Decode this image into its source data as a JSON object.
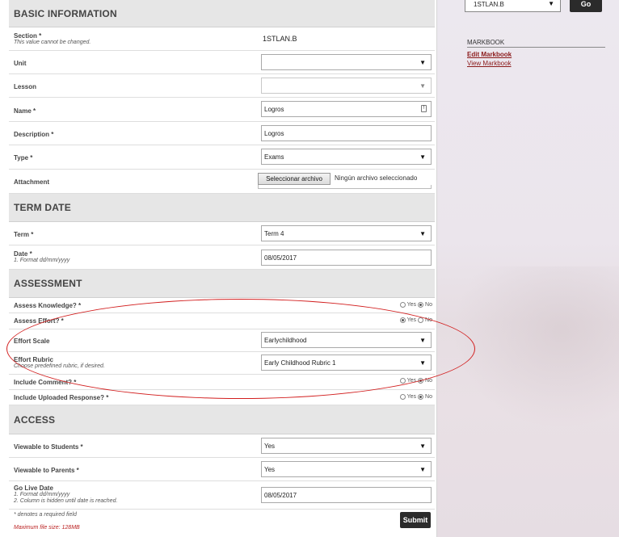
{
  "sidebar": {
    "class_select_value": "1STLAN.B",
    "go_label": "Go",
    "markbook_title": "MARKBOOK",
    "edit_link": "Edit Markbook",
    "view_link": "View Markbook"
  },
  "sections": {
    "basic": "BASIC INFORMATION",
    "term": "TERM DATE",
    "assessment": "ASSESSMENT",
    "access": "ACCESS"
  },
  "basic": {
    "section_label": "Section *",
    "section_note": "This value cannot be changed.",
    "section_value": "1STLAN.B",
    "unit_label": "Unit",
    "unit_value": "",
    "lesson_label": "Lesson",
    "lesson_value": "",
    "name_label": "Name *",
    "name_value": "Logros",
    "description_label": "Description *",
    "description_value": "Logros",
    "type_label": "Type *",
    "type_value": "Exams",
    "attachment_label": "Attachment",
    "attachment_button": "Seleccionar archivo",
    "attachment_status": "Ningún archivo seleccionado"
  },
  "term": {
    "term_label": "Term *",
    "term_value": "Term 4",
    "date_label": "Date *",
    "date_note": "1. Format dd/mm/yyyy",
    "date_value": "08/05/2017"
  },
  "assessment": {
    "knowledge_label": "Assess Knowledge? *",
    "knowledge_selected": "No",
    "effort_label": "Assess Effort? *",
    "effort_selected": "Yes",
    "scale_label": "Effort Scale",
    "scale_value": "Earlychildhood",
    "rubric_label": "Effort Rubric",
    "rubric_note": "Choose predefined rubric, if desired.",
    "rubric_value": "Early Childhood Rubric 1",
    "comment_label": "Include Comment? *",
    "comment_selected": "No",
    "uploaded_label": "Include Uploaded Response? *",
    "uploaded_selected": "No",
    "yes": "Yes",
    "no": "No"
  },
  "access": {
    "students_label": "Viewable to Students *",
    "students_value": "Yes",
    "parents_label": "Viewable to Parents *",
    "parents_value": "Yes",
    "golive_label": "Go Live Date",
    "golive_note1": "1. Format dd/mm/yyyy",
    "golive_note2": "2. Column is hidden until date is reached.",
    "golive_value": "08/05/2017",
    "required_note": "* denotes a required field",
    "max_size_note": "Maximum file size: 128MB",
    "submit_label": "Submit"
  },
  "colors": {
    "annotation_ellipse": "#d21e1e",
    "link": "#8b1a1a",
    "button_dark": "#2b2b2b"
  }
}
